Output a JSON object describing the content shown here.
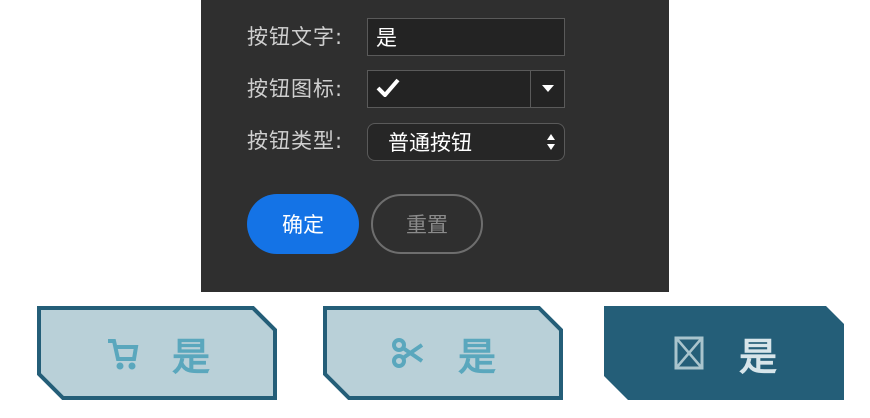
{
  "form": {
    "text_label": "按钮文字:",
    "text_value": "是",
    "icon_label": "按钮图标:",
    "icon_value": "checkmark-icon",
    "type_label": "按钮类型:",
    "type_value": "普通按钮"
  },
  "actions": {
    "confirm_label": "确定",
    "reset_label": "重置"
  },
  "previews": [
    {
      "icon": "cart-icon",
      "label": "是",
      "style": "light"
    },
    {
      "icon": "scissors-icon",
      "label": "是",
      "style": "light"
    },
    {
      "icon": "cross-box-icon",
      "label": "是",
      "style": "dark"
    }
  ],
  "colors": {
    "panel_bg": "#2f2f2f",
    "primary": "#1473e6",
    "preview_light": "#b9d0d8",
    "preview_dark": "#245e78",
    "preview_border": "#245e78",
    "preview_text_light": "#5aa7bd"
  }
}
